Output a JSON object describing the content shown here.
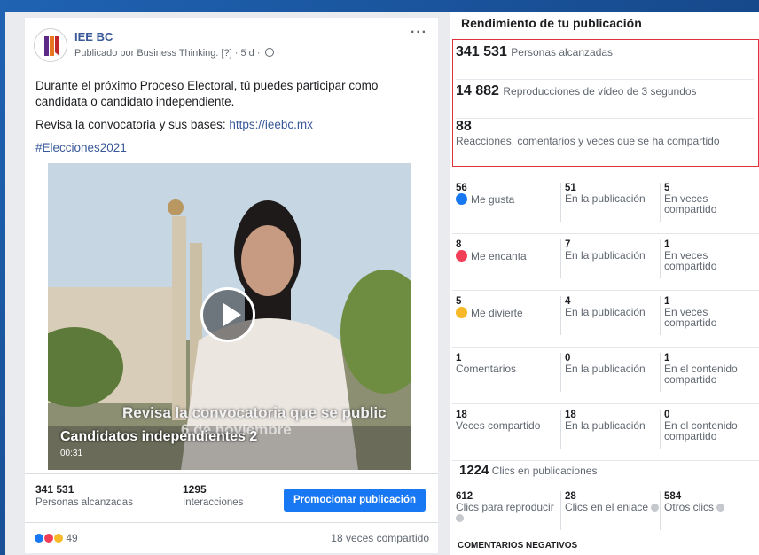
{
  "post": {
    "page_name": "IEE BC",
    "meta": "Publicado por Business Thinking. [?] · 5 d ·",
    "text_line1": "Durante el próximo Proceso Electoral, tú puedes participar como candidata o candidato independiente.",
    "text_line2_prefix": "Revisa la convocatoria y sus bases: ",
    "link": "https://ieebc.mx",
    "hashtag": "#Elecciones2021",
    "video": {
      "caption_top": "Revisa la convocatoria que se public",
      "caption_bottom": "6 de noviembre",
      "title": "Candidatos independientes 2",
      "duration": "00:31"
    },
    "stats": {
      "reach_value": "341 531",
      "reach_label": "Personas alcanzadas",
      "interactions_value": "1295",
      "interactions_label": "Interacciones",
      "promote_label": "Promocionar publicación"
    },
    "reactions_count": "49",
    "shares_text": "18 veces compartido"
  },
  "panel": {
    "title": "Rendimiento de tu publicación",
    "metrics": [
      {
        "value": "341 531",
        "label": "Personas alcanzadas"
      },
      {
        "value": "14 882",
        "label": "Reproducciones de vídeo de 3 segundos"
      },
      {
        "value": "88",
        "label": "Reacciones, comentarios y veces que se ha compartido"
      }
    ],
    "breakdown": [
      {
        "c1_num": "56",
        "c1_label": "Me gusta",
        "c2_num": "51",
        "c2_label": "En la publicación",
        "c3_num": "5",
        "c3_label": "En veces compartido"
      },
      {
        "c1_num": "8",
        "c1_label": "Me encanta",
        "c2_num": "7",
        "c2_label": "En la publicación",
        "c3_num": "1",
        "c3_label": "En veces compartido"
      },
      {
        "c1_num": "5",
        "c1_label": "Me divierte",
        "c2_num": "4",
        "c2_label": "En la publicación",
        "c3_num": "1",
        "c3_label": "En veces compartido"
      },
      {
        "c1_num": "1",
        "c1_label": "Comentarios",
        "c2_num": "0",
        "c2_label": "En la publicación",
        "c3_num": "1",
        "c3_label": "En el contenido compartido"
      },
      {
        "c1_num": "18",
        "c1_label": "Veces compartido",
        "c2_num": "18",
        "c2_label": "En la publicación",
        "c3_num": "0",
        "c3_label": "En el contenido compartido"
      }
    ],
    "clicks_total": "1224",
    "clicks_label": "Clics en publicaciones",
    "clicks": [
      {
        "num": "612",
        "label": "Clics para reproducir"
      },
      {
        "num": "28",
        "label": "Clics en el enlace"
      },
      {
        "num": "584",
        "label": "Otros clics"
      }
    ],
    "negative_title": "COMENTARIOS NEGATIVOS"
  },
  "colors": {
    "like": "#1877f2",
    "love": "#f33e58",
    "haha": "#f7b928",
    "highlight": "#e0323b"
  }
}
